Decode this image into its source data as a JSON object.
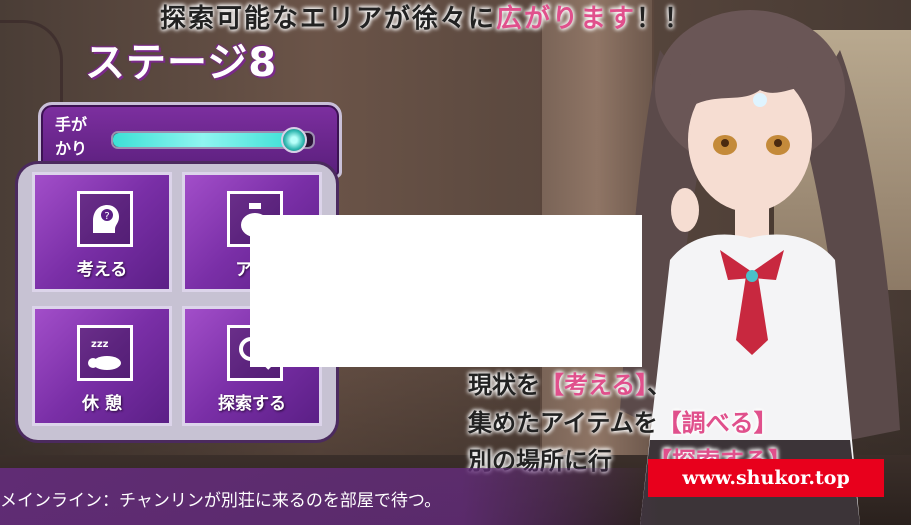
{
  "banner": {
    "text_main": "探索可能なエリアが徐々に",
    "text_accent": "広がります",
    "text_end": "！！"
  },
  "stage": {
    "title": "ステージ8"
  },
  "hint": {
    "label": "手がかり",
    "progress": 0.9
  },
  "menu": {
    "items": [
      {
        "label": "考える",
        "icon": "head-question-icon"
      },
      {
        "label": "アイ",
        "icon": "item-bag-icon"
      },
      {
        "label": "休 憩",
        "icon": "sleep-icon"
      },
      {
        "label": "探索する",
        "icon": "magnifier-icon"
      }
    ]
  },
  "instructions": {
    "line1_a": "現状を",
    "line1_accent": "【考える】",
    "line1_b": "、",
    "line2_a": "集めたアイテムを",
    "line2_accent": "【調べる】",
    "line3_a": "別の場所に行",
    "line3_accent": "【探索する】"
  },
  "mission": {
    "text": "メインライン：チャンリンが別荘に来るのを部屋で待つ。"
  },
  "watermark": {
    "text": "www.shukor.top"
  },
  "colors": {
    "accent_pink": "#e0508c",
    "menu_purple": "#7a2fa7",
    "hint_fill": "#3de0d6",
    "watermark_red": "#e8001c"
  }
}
